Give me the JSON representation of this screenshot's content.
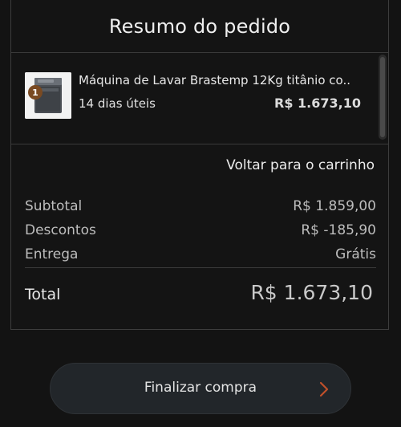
{
  "order_summary": {
    "title": "Resumo do pedido",
    "item": {
      "name": "Máquina de Lavar Brastemp 12Kg titânio co...",
      "delivery": "14 dias úteis",
      "price": "R$ 1.673,10",
      "quantity": "1",
      "image_icon": "washing-machine-icon"
    },
    "back_to_cart": "Voltar para o carrinho",
    "subtotal": {
      "label": "Subtotal",
      "value": "R$ 1.859,00"
    },
    "discounts": {
      "label": "Descontos",
      "value": "R$ -185,90"
    },
    "delivery": {
      "label": "Entrega",
      "value": "Grátis"
    },
    "total": {
      "label": "Total",
      "value": "R$ 1.673,10"
    }
  },
  "checkout": {
    "label": "Finalizar compra",
    "accent_color": "#c0502a"
  }
}
